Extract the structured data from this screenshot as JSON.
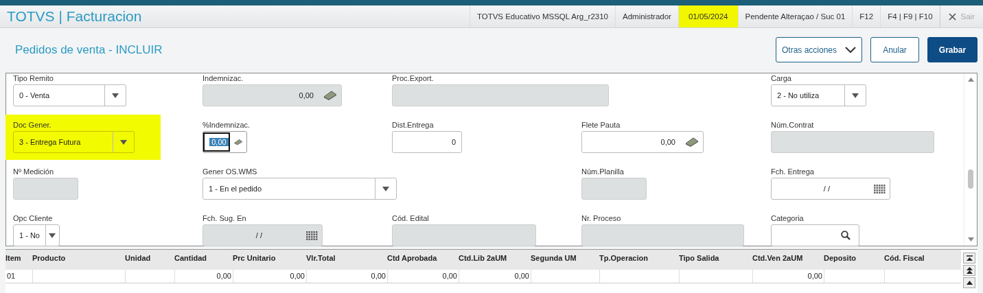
{
  "app_title": "TOTVS | Facturacion",
  "header_items": [
    {
      "label": "TOTVS Educativo MSSQL Arg_r2310",
      "highlighted": false
    },
    {
      "label": "Administrador",
      "highlighted": false
    },
    {
      "label": "01/05/2024",
      "highlighted": true
    },
    {
      "label": "Pendente Alteraçao / Suc 01",
      "highlighted": false
    },
    {
      "label": "F12",
      "highlighted": false
    },
    {
      "label": "F4 | F9 | F10",
      "highlighted": false
    }
  ],
  "exit_button": {
    "label": "Sair",
    "disabled": true
  },
  "page_title": "Pedidos de venta - INCLUIR",
  "actions": [
    {
      "label": "Otras acciones",
      "kind": "menu"
    },
    {
      "label": "Anular",
      "kind": "secondary"
    },
    {
      "label": "Grabar",
      "kind": "primary"
    }
  ],
  "form_rows": [
    [
      {
        "kind": "select",
        "label": "Tipo Remito",
        "value": "0 - Venta",
        "highlighted": false
      },
      {
        "kind": "money",
        "label": "Indemnizac.",
        "value": "0,00",
        "disabled": true,
        "highlighted": false,
        "focused": false
      },
      {
        "kind": "text",
        "label": "Proc.Export.",
        "disabled": true,
        "highlighted": false
      },
      {
        "kind": "empty"
      },
      {
        "kind": "select",
        "label": "Carga",
        "value": "2 - No utiliza",
        "highlighted": false
      }
    ],
    [
      {
        "kind": "select",
        "label": "Doc Gener.",
        "value": "3 - Entrega Futura",
        "highlighted": true
      },
      {
        "kind": "money",
        "label": "%Indemnizac.",
        "value": "0,00",
        "disabled": false,
        "highlighted": false,
        "focused": true
      },
      {
        "kind": "text",
        "label": "Dist.Entrega",
        "value": "0",
        "disabled": false,
        "highlighted": false
      },
      {
        "kind": "money",
        "label": "Flete Pauta",
        "value": "0,00",
        "disabled": false,
        "highlighted": false,
        "focused": false
      },
      {
        "kind": "text",
        "label": "Núm.Contrat",
        "disabled": true,
        "highlighted": false
      }
    ],
    [
      {
        "kind": "text",
        "label": "Nº Medición",
        "disabled": true,
        "highlighted": false
      },
      {
        "kind": "select",
        "label": "Gener OS.WMS",
        "value": "1 - En el pedido",
        "highlighted": false
      },
      {
        "kind": "empty"
      },
      {
        "kind": "text",
        "label": "Núm.Planilla",
        "disabled": true,
        "highlighted": false
      },
      {
        "kind": "date",
        "label": "Fch. Entrega",
        "value": "/ /",
        "disabled": false,
        "highlighted": false
      }
    ],
    [
      {
        "kind": "select",
        "label": "Opc Cliente",
        "value": "1 - No",
        "highlighted": false
      },
      {
        "kind": "date",
        "label": "Fch. Sug. En",
        "value": "/ /",
        "disabled": true,
        "highlighted": false
      },
      {
        "kind": "text",
        "label": "Cód. Edital",
        "disabled": true,
        "highlighted": false
      },
      {
        "kind": "text",
        "label": "Nr. Proceso",
        "disabled": true,
        "highlighted": false
      },
      {
        "kind": "lookup",
        "label": "Categoria",
        "highlighted": false
      }
    ]
  ],
  "table": {
    "columns": [
      "Item",
      "Producto",
      "Unidad",
      "Cantidad",
      "Prc Unitario",
      "Vlr.Total",
      "Ctd Aprobada",
      "Ctd.Lib 2aUM",
      "Segunda UM",
      "Tp.Operacion",
      "Tipo Salida",
      "Ctd.Ven 2aUM",
      "Deposito",
      "Cód. Fiscal"
    ],
    "rows": [
      [
        "01",
        null,
        null,
        "0,00",
        "0,00",
        "0,00",
        "0,00",
        "0,00",
        null,
        null,
        null,
        "0,00",
        null,
        null
      ]
    ]
  }
}
